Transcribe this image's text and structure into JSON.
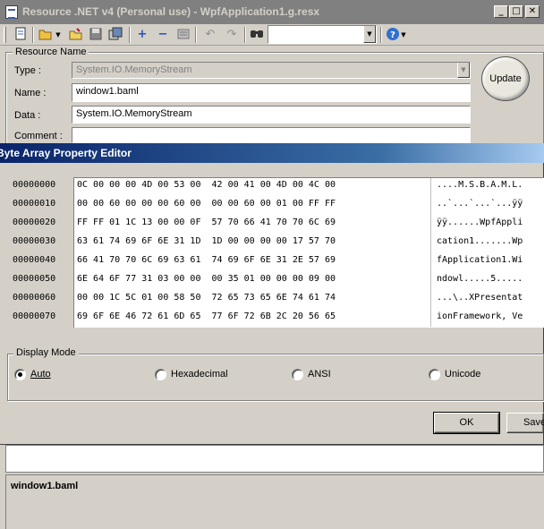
{
  "window": {
    "title": "Resource .NET v4 (Personal  use) - WpfApplication1.g.resx",
    "minimize": "_",
    "maximize": "□",
    "close": "✕"
  },
  "toolbar": {
    "icons": [
      "new-file-icon",
      "open-folder-icon",
      "open-dropdown-icon",
      "folder-icon",
      "save-icon",
      "save-all-icon",
      "add-icon",
      "remove-icon",
      "properties-icon",
      "undo-icon",
      "redo-icon",
      "find-icon",
      "help-icon",
      "help-dropdown-icon"
    ],
    "search_value": "",
    "help_symbol": "?"
  },
  "resource": {
    "group_label": "Resource Name",
    "type_label": "Type :",
    "type_value": "System.IO.MemoryStream",
    "name_label": "Name :",
    "name_value": "window1.baml",
    "data_label": "Data :",
    "data_value": "System.IO.MemoryStream",
    "comment_label": "Comment :",
    "comment_value": "",
    "update_button": "Update"
  },
  "dialog": {
    "title": "Byte Array Property Editor",
    "rows": [
      {
        "addr": "00000000",
        "hex": "0C 00 00 00 4D 00 53 00  42 00 41 00 4D 00 4C 00",
        "ascii": "....M.S.B.A.M.L."
      },
      {
        "addr": "00000010",
        "hex": "00 00 60 00 00 00 60 00  00 00 60 00 01 00 FF FF",
        "ascii": "..`...`...`...ÿÿ"
      },
      {
        "addr": "00000020",
        "hex": "FF FF 01 1C 13 00 00 0F  57 70 66 41 70 70 6C 69",
        "ascii": "ÿÿ......WpfAppli"
      },
      {
        "addr": "00000030",
        "hex": "63 61 74 69 6F 6E 31 1D  1D 00 00 00 00 17 57 70",
        "ascii": "cation1.......Wp"
      },
      {
        "addr": "00000040",
        "hex": "66 41 70 70 6C 69 63 61  74 69 6F 6E 31 2E 57 69",
        "ascii": "fApplication1.Wi"
      },
      {
        "addr": "00000050",
        "hex": "6E 64 6F 77 31 03 00 00  00 35 01 00 00 00 09 00",
        "ascii": "ndowl.....5....."
      },
      {
        "addr": "00000060",
        "hex": "00 00 1C 5C 01 00 58 50  72 65 73 65 6E 74 61 74",
        "ascii": "...\\..XPresentat"
      },
      {
        "addr": "00000070",
        "hex": "69 6F 6E 46 72 61 6D 65  77 6F 72 6B 2C 20 56 65",
        "ascii": "ionFramework, Ve"
      }
    ],
    "display_mode": {
      "label": "Display Mode",
      "options": [
        "Auto",
        "Hexadecimal",
        "ANSI",
        "Unicode"
      ],
      "selected": "Auto"
    },
    "ok_button": "OK",
    "save_button": "Save"
  },
  "status": {
    "text": "window1.baml"
  }
}
